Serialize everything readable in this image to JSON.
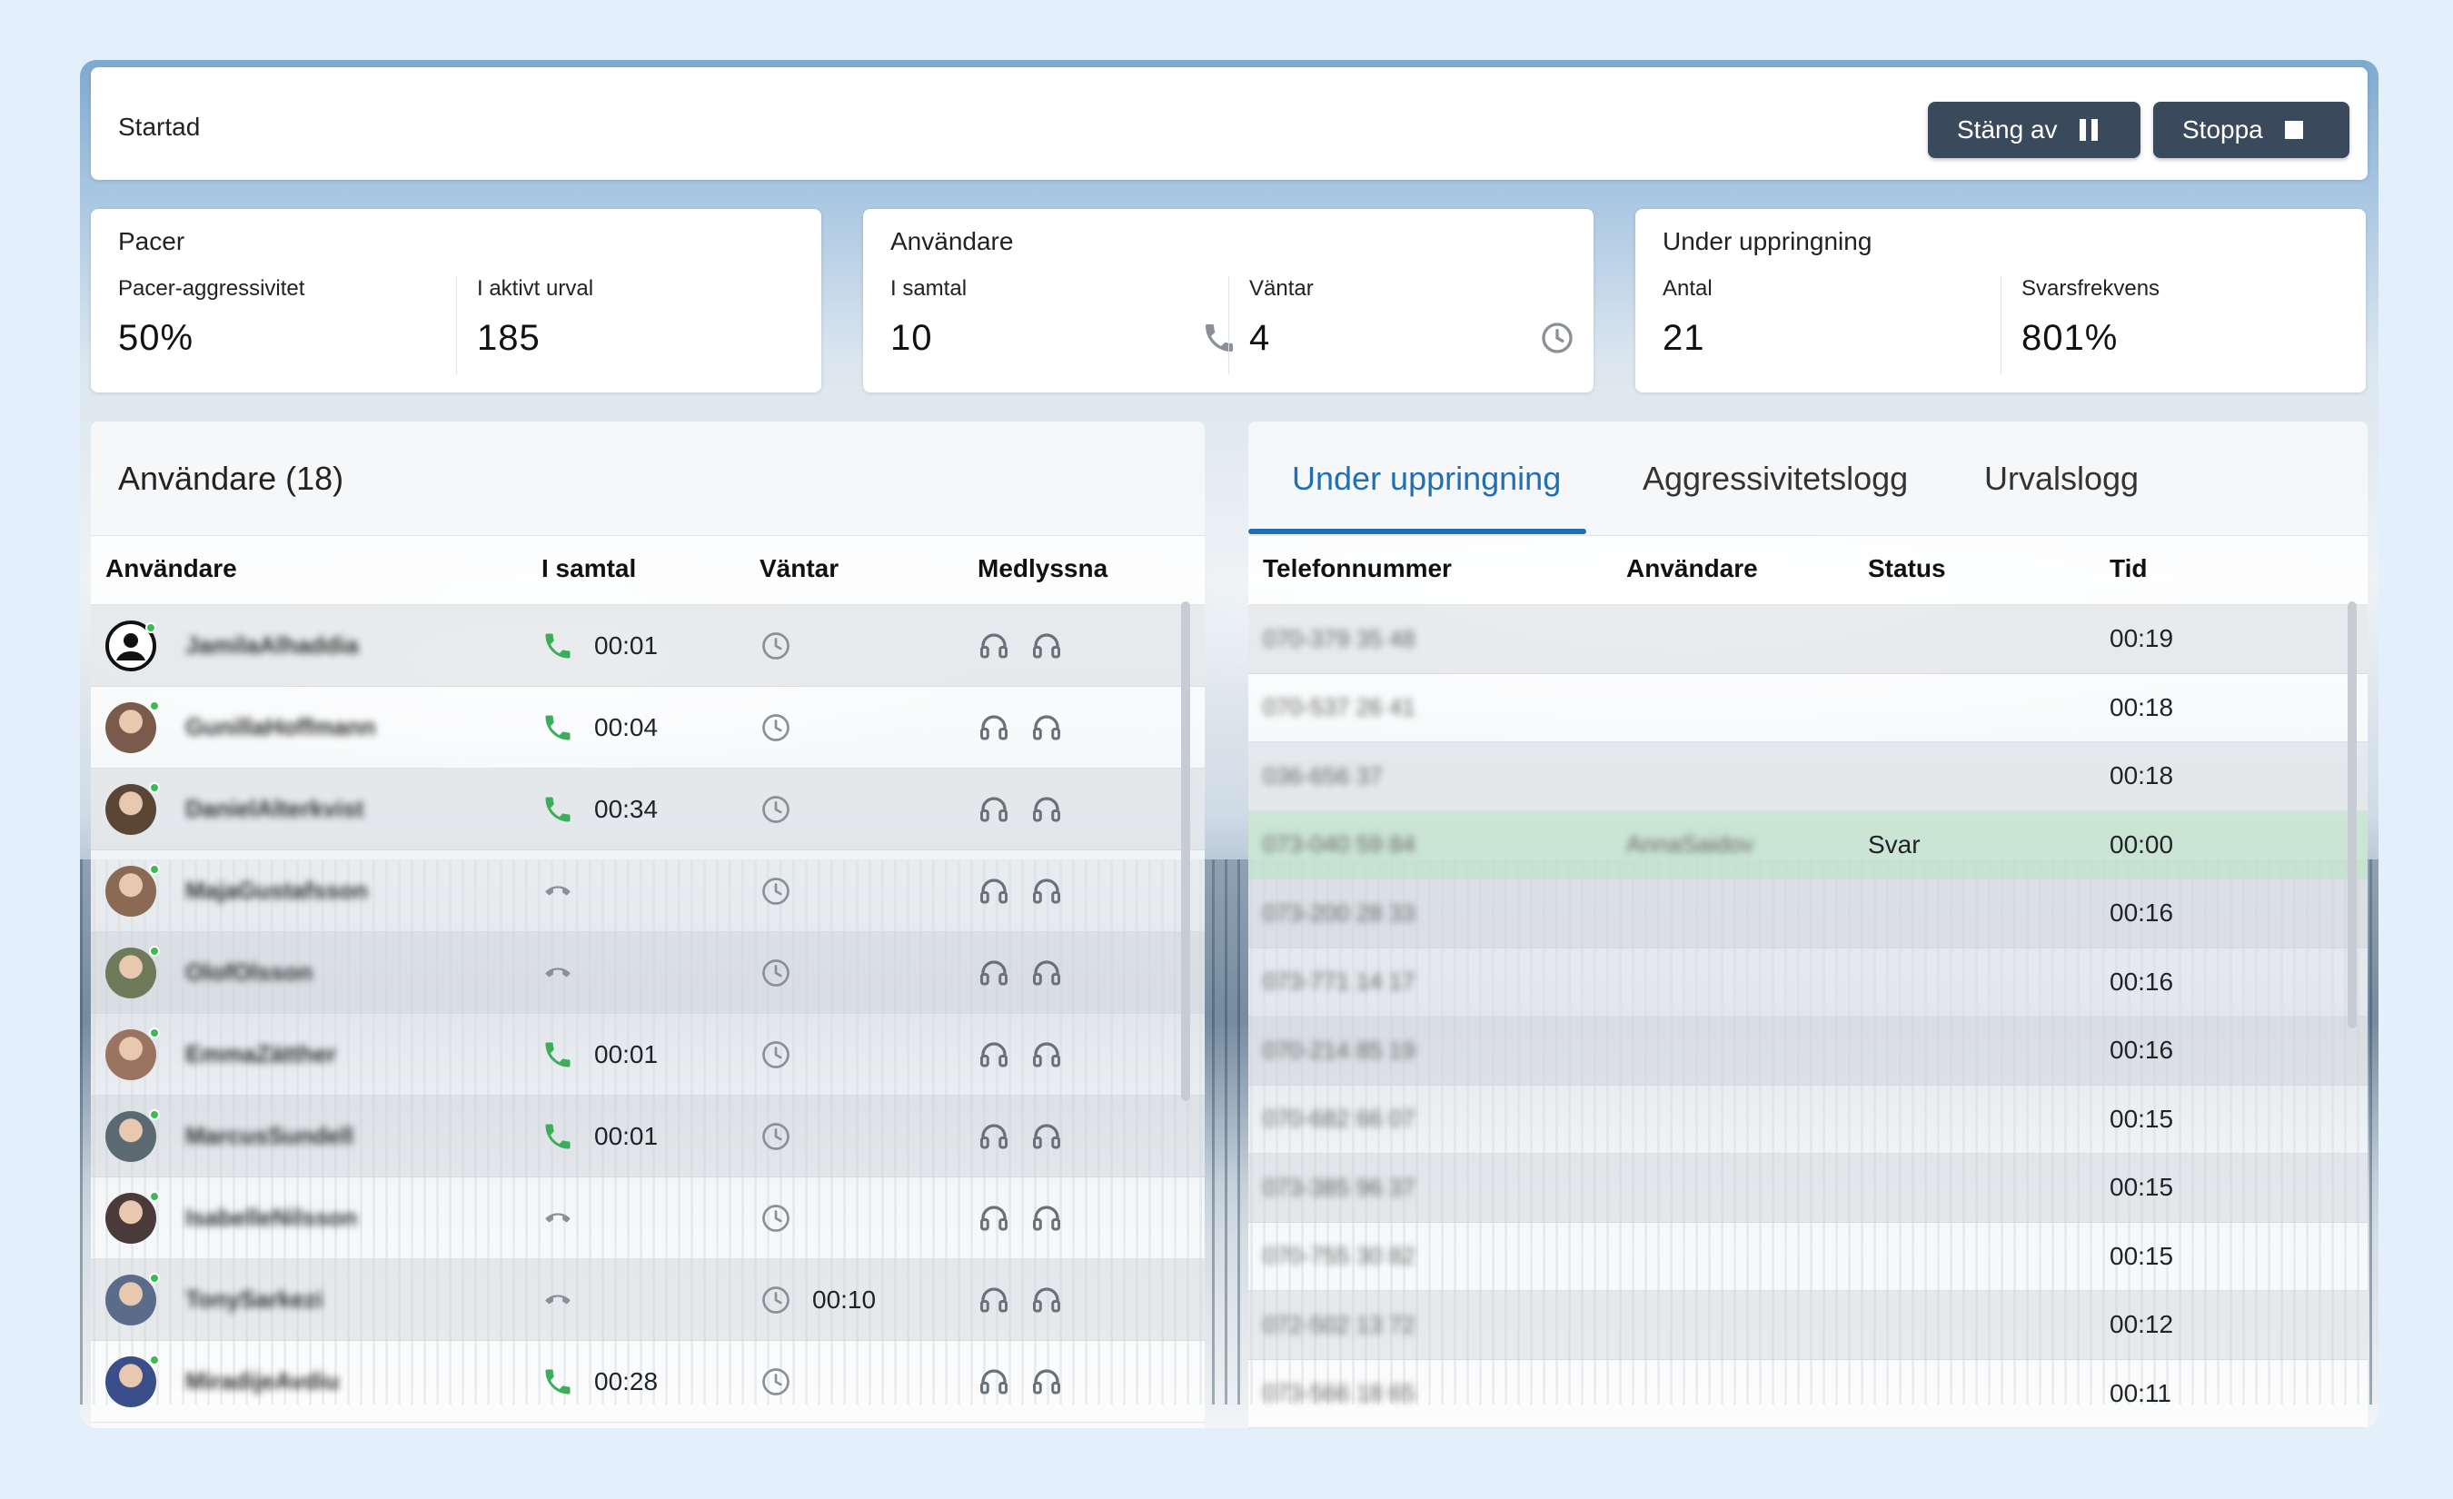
{
  "status": {
    "text": "Startad",
    "pause_label": "Stäng av",
    "stop_label": "Stoppa"
  },
  "stats": {
    "pacer": {
      "title": "Pacer",
      "aggr_label": "Pacer-aggressivitet",
      "aggr_value": "50%",
      "selection_label": "I aktivt urval",
      "selection_value": "185"
    },
    "users": {
      "title": "Användare",
      "incall_label": "I samtal",
      "incall_value": "10",
      "waiting_label": "Väntar",
      "waiting_value": "4"
    },
    "dialing": {
      "title": "Under uppringning",
      "count_label": "Antal",
      "count_value": "21",
      "rate_label": "Svarsfrekvens",
      "rate_value": "801%"
    }
  },
  "users_panel": {
    "title": "Användare (18)",
    "columns": [
      "Användare",
      "I samtal",
      "Väntar",
      "Medlyssna"
    ],
    "rows": [
      {
        "name": "JamilaAlhaddia",
        "in_call": true,
        "call_time": "00:01",
        "wait_time": ""
      },
      {
        "name": "GunillaHoffmann",
        "in_call": true,
        "call_time": "00:04",
        "wait_time": ""
      },
      {
        "name": "DanielAlterkvist",
        "in_call": true,
        "call_time": "00:34",
        "wait_time": ""
      },
      {
        "name": "MajaGustafsson",
        "in_call": false,
        "call_time": "",
        "wait_time": ""
      },
      {
        "name": "OlofOlsson",
        "in_call": false,
        "call_time": "",
        "wait_time": ""
      },
      {
        "name": "EmmaZätther",
        "in_call": true,
        "call_time": "00:01",
        "wait_time": ""
      },
      {
        "name": "MarcusSundell",
        "in_call": true,
        "call_time": "00:01",
        "wait_time": ""
      },
      {
        "name": "IsabelleNilsson",
        "in_call": false,
        "call_time": "",
        "wait_time": ""
      },
      {
        "name": "TonySarkezi",
        "in_call": false,
        "call_time": "",
        "wait_time": "00:10"
      },
      {
        "name": "MiradijeAvdiu",
        "in_call": true,
        "call_time": "00:28",
        "wait_time": ""
      }
    ]
  },
  "dial_panel": {
    "tabs": [
      "Under uppringning",
      "Aggressivitetslogg",
      "Urvalslogg"
    ],
    "columns": [
      "Telefonnummer",
      "Användare",
      "Status",
      "Tid"
    ],
    "rows": [
      {
        "phone": "070-379 35 48",
        "user": "",
        "status": "",
        "time": "00:19"
      },
      {
        "phone": "070-537 26 41",
        "user": "",
        "status": "",
        "time": "00:18"
      },
      {
        "phone": "036-656 37",
        "user": "",
        "status": "",
        "time": "00:18"
      },
      {
        "phone": "073-040 59 84",
        "user": "AnnaSaidov",
        "status": "Svar",
        "time": "00:00"
      },
      {
        "phone": "073-200 28 33",
        "user": "",
        "status": "",
        "time": "00:16"
      },
      {
        "phone": "073-771 14 17",
        "user": "",
        "status": "",
        "time": "00:16"
      },
      {
        "phone": "070-214 85 19",
        "user": "",
        "status": "",
        "time": "00:16"
      },
      {
        "phone": "070-682 66 07",
        "user": "",
        "status": "",
        "time": "00:15"
      },
      {
        "phone": "073-385 96 37",
        "user": "",
        "status": "",
        "time": "00:15"
      },
      {
        "phone": "070-755 30 82",
        "user": "",
        "status": "",
        "time": "00:15"
      },
      {
        "phone": "072-502 13 72",
        "user": "",
        "status": "",
        "time": "00:12"
      },
      {
        "phone": "073-566 18 65",
        "user": "",
        "status": "",
        "time": "00:11"
      }
    ]
  },
  "colors": {
    "accent": "#1f6fb5",
    "call_green": "#3cae5a",
    "button_bg": "#3a4a5c",
    "answered_row": "#c6e4ce"
  }
}
